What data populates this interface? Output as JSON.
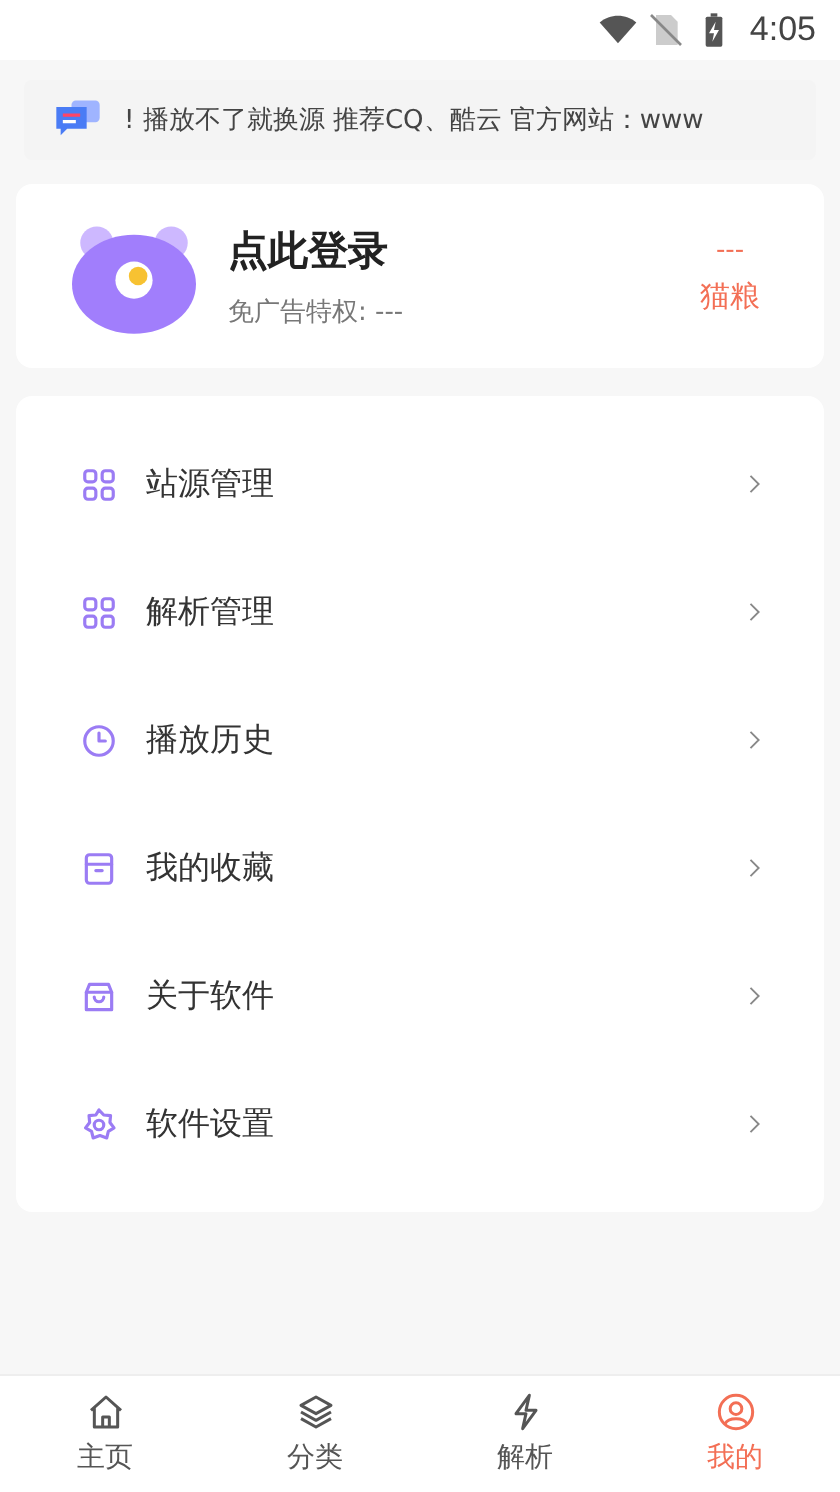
{
  "status_bar": {
    "time": "4:05"
  },
  "notice": {
    "text": "!   播放不了就换源 推荐CQ、酷云  官方网站：www"
  },
  "profile": {
    "title": "点此登录",
    "subtitle": "免广告特权: ---",
    "points_value": "---",
    "points_label": "猫粮"
  },
  "menu": [
    {
      "kind": "grid",
      "label": "站源管理"
    },
    {
      "kind": "grid",
      "label": "解析管理"
    },
    {
      "kind": "clock",
      "label": "播放历史"
    },
    {
      "kind": "archive",
      "label": "我的收藏"
    },
    {
      "kind": "bag",
      "label": "关于软件"
    },
    {
      "kind": "flower",
      "label": "软件设置"
    }
  ],
  "tabs": [
    {
      "kind": "home",
      "label": "主页",
      "selected": false
    },
    {
      "kind": "layers",
      "label": "分类",
      "selected": false
    },
    {
      "kind": "bolt",
      "label": "解析",
      "selected": false
    },
    {
      "kind": "user",
      "label": "我的",
      "selected": true
    }
  ]
}
